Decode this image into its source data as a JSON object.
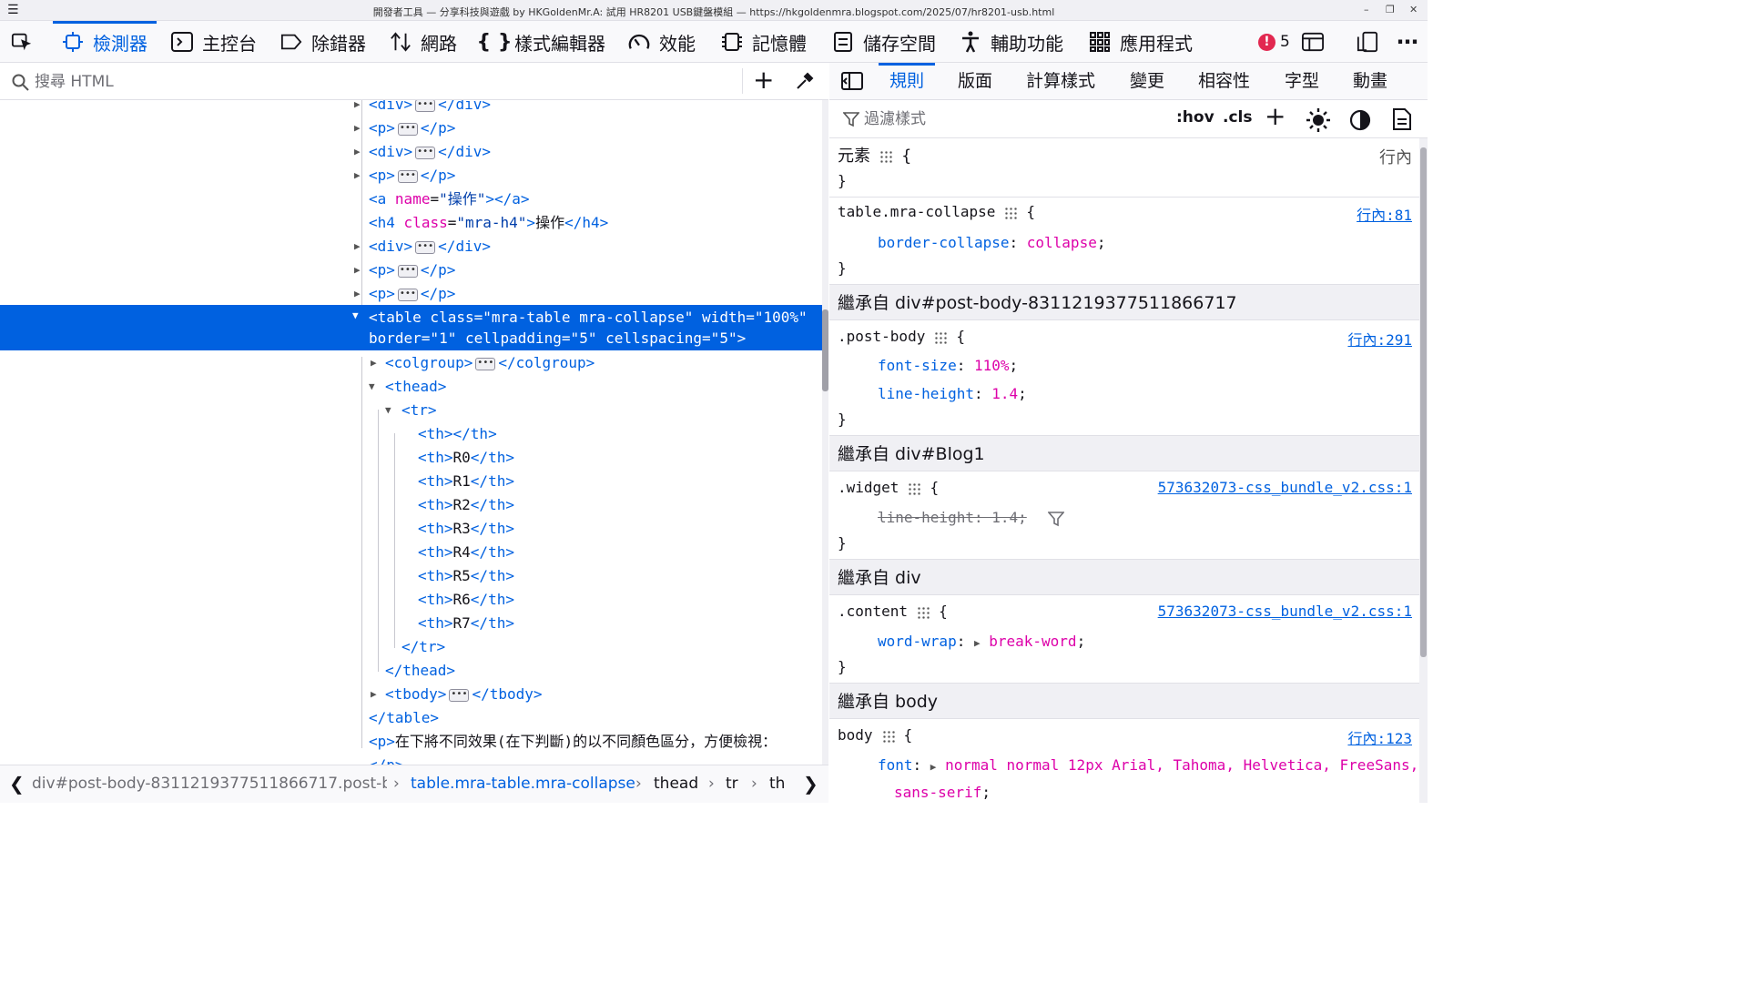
{
  "window": {
    "title": "開發者工具 — 分享科技與遊戲 by HKGoldenMr.A: 試用 HR8201 USB鍵盤模組 — https://hkgoldenmra.blogspot.com/2025/07/hr8201-usb.html"
  },
  "toolbar": {
    "tools": [
      {
        "label": "檢測器",
        "icon": "inspector-icon"
      },
      {
        "label": "主控台",
        "icon": "console-icon"
      },
      {
        "label": "除錯器",
        "icon": "debugger-icon"
      },
      {
        "label": "網路",
        "icon": "network-icon"
      },
      {
        "label": "樣式編輯器",
        "icon": "style-editor-icon"
      },
      {
        "label": "效能",
        "icon": "performance-icon"
      },
      {
        "label": "記憶體",
        "icon": "memory-icon"
      },
      {
        "label": "儲存空間",
        "icon": "storage-icon"
      },
      {
        "label": "輔助功能",
        "icon": "accessibility-icon"
      },
      {
        "label": "應用程式",
        "icon": "application-icon"
      }
    ],
    "error_count": "5"
  },
  "markup": {
    "search_placeholder": "搜尋 HTML",
    "lines": [
      {
        "open": "<div>",
        "close": "</div>"
      },
      {
        "open": "<p>",
        "close": "</p>"
      },
      {
        "open": "<div>",
        "close": "</div>"
      },
      {
        "open": "<p>",
        "close": "</p>"
      },
      {
        "a_tag": "a",
        "a_attr": "name",
        "a_val": "\"操作\"",
        "a_close": "></a>"
      },
      {
        "h4_attr": "class",
        "h4_val": "\"mra-h4\"",
        "h4_text": "操作"
      },
      {
        "open": "<div>",
        "close": "</div>"
      },
      {
        "open": "<p>",
        "close": "</p>"
      },
      {
        "open": "<p>",
        "close": "</p>"
      },
      {
        "table_line1": "<table class=\"mra-table mra-collapse\" width=\"100%\"",
        "table_line2": "border=\"1\" cellpadding=\"5\" cellspacing=\"5\">"
      },
      {
        "open": "<colgroup>",
        "close": "</colgroup>"
      },
      {
        "text": "<thead>"
      },
      {
        "text": "<tr>"
      },
      {
        "th": ""
      },
      {
        "th": "R0"
      },
      {
        "th": "R1"
      },
      {
        "th": "R2"
      },
      {
        "th": "R3"
      },
      {
        "th": "R4"
      },
      {
        "th": "R5"
      },
      {
        "th": "R6"
      },
      {
        "th": "R7"
      },
      {
        "text": "</tr>"
      },
      {
        "text": "</thead>"
      },
      {
        "open": "<tbody>",
        "close": "</tbody>"
      },
      {
        "text": "</table>"
      },
      {
        "p_text": "在下將不同效果(在下判斷)的以不同顏色區分，方便檢視："
      },
      {
        "text": "</p>"
      }
    ]
  },
  "breadcrumb": {
    "items": [
      "div#post-body-8311219377511866717.post-b…",
      "table.mra-table.mra-collapse",
      "thead",
      "tr",
      "th"
    ]
  },
  "rules_panel": {
    "tabs": [
      "規則",
      "版面",
      "計算樣式",
      "變更",
      "相容性",
      "字型",
      "動畫"
    ],
    "filter_placeholder": "過濾樣式",
    "hov": ":hov",
    "cls": ".cls",
    "element": {
      "selector": "元素",
      "source": "行內"
    },
    "rule1": {
      "selector": "table.mra-collapse",
      "source": "行內:81",
      "prop": "border-collapse",
      "value": "collapse"
    },
    "inherit1": "繼承自 div#post-body-8311219377511866717",
    "rule2": {
      "selector": ".post-body",
      "source": "行內:291",
      "props": [
        {
          "prop": "font-size",
          "value": "110%"
        },
        {
          "prop": "line-height",
          "value": "1.4"
        }
      ]
    },
    "inherit2": "繼承自 div#Blog1",
    "rule3": {
      "selector": ".widget",
      "source": "573632073-css_bundle_v2.css:1",
      "prop": "line-height: 1.4;"
    },
    "inherit3": "繼承自 div",
    "rule4": {
      "selector": ".content",
      "source": "573632073-css_bundle_v2.css:1",
      "prop": "word-wrap",
      "value": "break-word"
    },
    "inherit4": "繼承自 body",
    "rule5": {
      "selector": "body",
      "source": "行內:123",
      "prop": "font",
      "value": "normal normal 12px Arial, Tahoma, Helvetica, FreeSans,",
      "value2": "sans-serif"
    }
  },
  "colors": {
    "accent": "#0061e0",
    "error": "#e22850",
    "prop_value": "#dd00a9"
  }
}
